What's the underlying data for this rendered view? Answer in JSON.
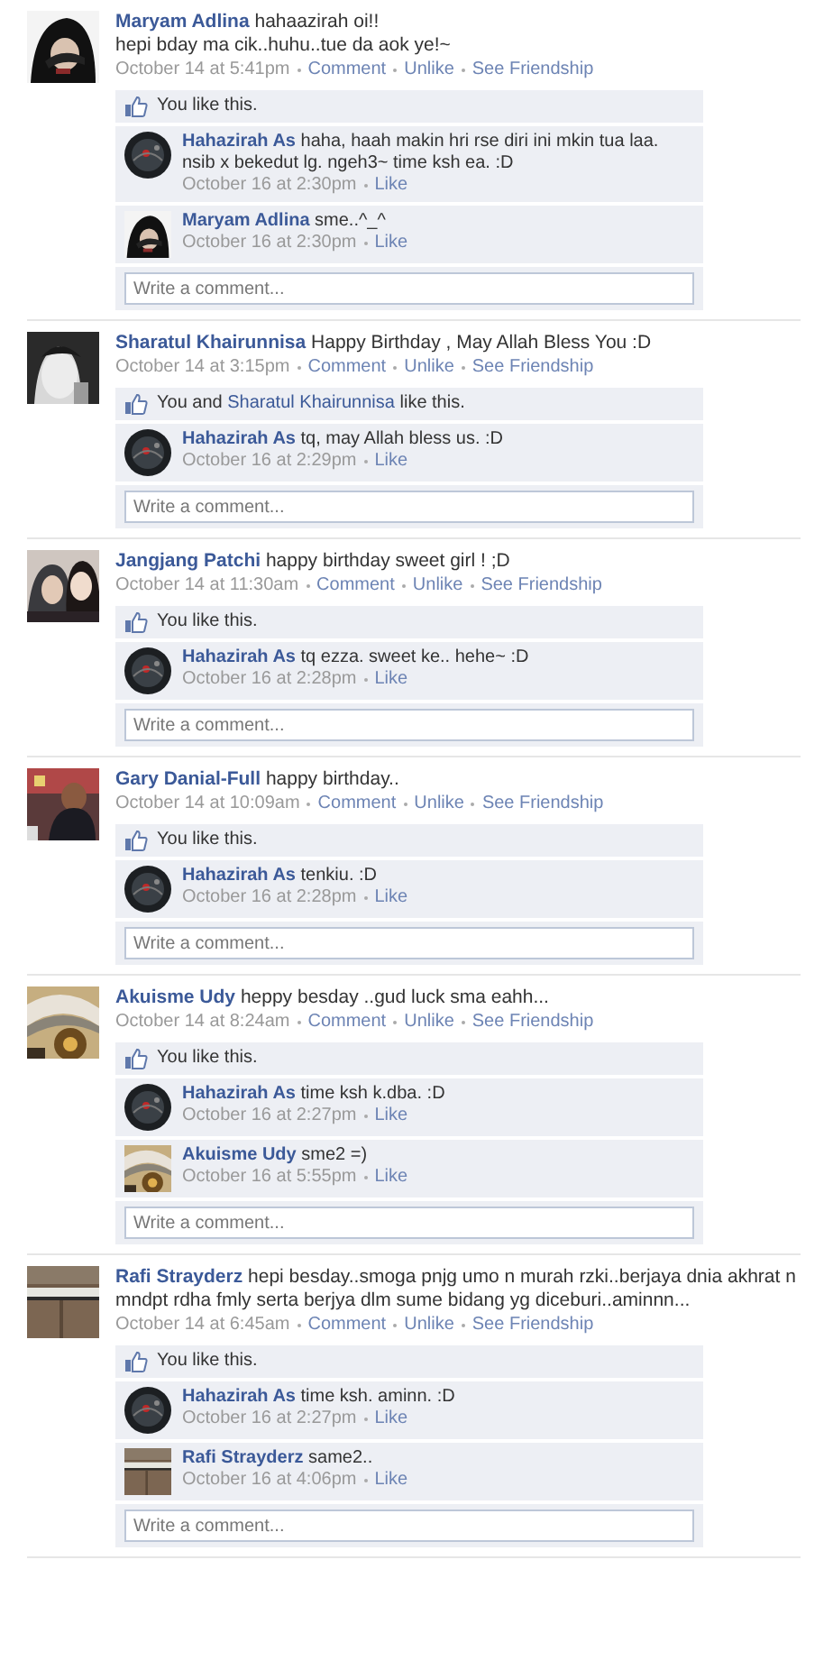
{
  "posts": [
    {
      "author": "Maryam Adlina",
      "message": "hahaazirah oi!!\nhepi bday ma cik..huhu..tue da aok ye!~",
      "time": "October 14 at 5:41pm",
      "actions": [
        "Comment",
        "Unlike",
        "See Friendship"
      ],
      "likes": [
        {
          "text": "You like this.",
          "kind": "plain"
        }
      ],
      "comments": [
        {
          "author": "Hahazirah As",
          "text": "haha, haah makin hri rse diri ini mkin tua laa. nsib x bekedut lg. ngeh3~ time ksh ea. :D",
          "time": "October 16 at 2:30pm",
          "action": "Like"
        },
        {
          "author": "Maryam Adlina",
          "text": "sme..^_^",
          "time": "October 16 at 2:30pm",
          "action": "Like"
        }
      ],
      "placeholder": "Write a comment..."
    },
    {
      "author": "Sharatul Khairunnisa",
      "message": "Happy Birthday , May Allah Bless You :D",
      "time": "October 14 at 3:15pm",
      "actions": [
        "Comment",
        "Unlike",
        "See Friendship"
      ],
      "likes": [
        {
          "text": "You and ",
          "kind": "plain"
        },
        {
          "text": "Sharatul Khairunnisa",
          "kind": "link"
        },
        {
          "text": " like this.",
          "kind": "plain"
        }
      ],
      "comments": [
        {
          "author": "Hahazirah As",
          "text": "tq, may Allah bless us. :D",
          "time": "October 16 at 2:29pm",
          "action": "Like"
        }
      ],
      "placeholder": "Write a comment..."
    },
    {
      "author": "Jangjang Patchi",
      "message": "happy birthday sweet girl ! ;D",
      "time": "October 14 at 11:30am",
      "actions": [
        "Comment",
        "Unlike",
        "See Friendship"
      ],
      "likes": [
        {
          "text": "You like this.",
          "kind": "plain"
        }
      ],
      "comments": [
        {
          "author": "Hahazirah As",
          "text": "tq ezza. sweet ke.. hehe~ :D",
          "time": "October 16 at 2:28pm",
          "action": "Like"
        }
      ],
      "placeholder": "Write a comment..."
    },
    {
      "author": "Gary Danial-Full",
      "message": "happy birthday..",
      "time": "October 14 at 10:09am",
      "actions": [
        "Comment",
        "Unlike",
        "See Friendship"
      ],
      "likes": [
        {
          "text": "You like this.",
          "kind": "plain"
        }
      ],
      "comments": [
        {
          "author": "Hahazirah As",
          "text": "tenkiu. :D",
          "time": "October 16 at 2:28pm",
          "action": "Like"
        }
      ],
      "placeholder": "Write a comment..."
    },
    {
      "author": "Akuisme Udy",
      "message": "heppy besday ..gud luck sma eahh...",
      "time": "October 14 at 8:24am",
      "actions": [
        "Comment",
        "Unlike",
        "See Friendship"
      ],
      "likes": [
        {
          "text": "You like this.",
          "kind": "plain"
        }
      ],
      "comments": [
        {
          "author": "Hahazirah As",
          "text": "time ksh k.dba. :D",
          "time": "October 16 at 2:27pm",
          "action": "Like"
        },
        {
          "author": "Akuisme Udy",
          "text": "sme2 =)",
          "time": "October 16 at 5:55pm",
          "action": "Like"
        }
      ],
      "placeholder": "Write a comment..."
    },
    {
      "author": "Rafi Strayderz",
      "message": "hepi besday..smoga pnjg umo n murah rzki..berjaya dnia akhrat n mndpt rdha fmly serta berjya dlm sume bidang yg diceburi..aminnn...",
      "time": "October 14 at 6:45am",
      "actions": [
        "Comment",
        "Unlike",
        "See Friendship"
      ],
      "likes": [
        {
          "text": "You like this.",
          "kind": "plain"
        }
      ],
      "comments": [
        {
          "author": "Hahazirah As",
          "text": "time ksh. aminn. :D",
          "time": "October 16 at 2:27pm",
          "action": "Like"
        },
        {
          "author": "Rafi Strayderz",
          "text": "same2..",
          "time": "October 16 at 4:06pm",
          "action": "Like"
        }
      ],
      "placeholder": "Write a comment..."
    }
  ]
}
